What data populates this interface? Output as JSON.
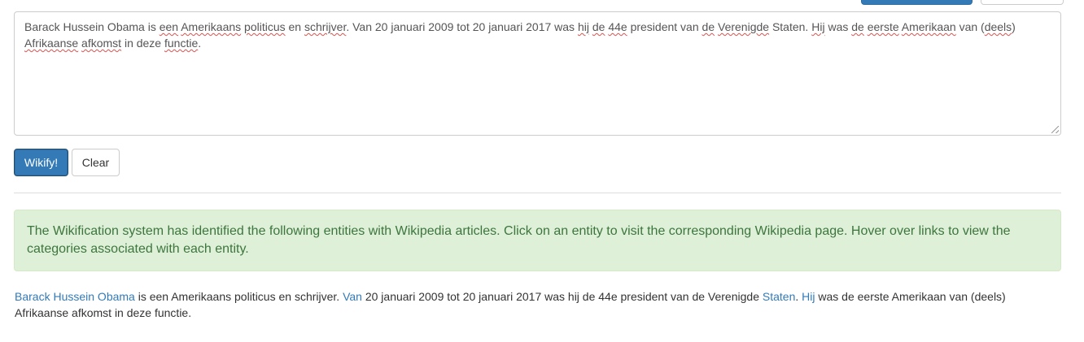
{
  "top_buttons": {
    "primary": "",
    "secondary": ""
  },
  "editor": {
    "segments": [
      {
        "text": "Barack Hussein Obama is ",
        "spell": false
      },
      {
        "text": "een",
        "spell": true
      },
      {
        "text": " ",
        "spell": false
      },
      {
        "text": "Amerikaans",
        "spell": true
      },
      {
        "text": " ",
        "spell": false
      },
      {
        "text": "politicus",
        "spell": true
      },
      {
        "text": " en ",
        "spell": false
      },
      {
        "text": "schrijver",
        "spell": true
      },
      {
        "text": ". Van 20 januari 2009 tot 20 januari 2017 was ",
        "spell": false
      },
      {
        "text": "hij",
        "spell": true
      },
      {
        "text": " ",
        "spell": false
      },
      {
        "text": "de",
        "spell": true
      },
      {
        "text": " ",
        "spell": false
      },
      {
        "text": "44e",
        "spell": true
      },
      {
        "text": " president van ",
        "spell": false
      },
      {
        "text": "de",
        "spell": true
      },
      {
        "text": " ",
        "spell": false
      },
      {
        "text": "Verenigde",
        "spell": true
      },
      {
        "text": " Staten. ",
        "spell": false
      },
      {
        "text": "Hij",
        "spell": true
      },
      {
        "text": " was ",
        "spell": false
      },
      {
        "text": "de",
        "spell": true
      },
      {
        "text": " ",
        "spell": false
      },
      {
        "text": "eerste",
        "spell": true
      },
      {
        "text": " ",
        "spell": false
      },
      {
        "text": "Amerikaan",
        "spell": true
      },
      {
        "text": " van (",
        "spell": false
      },
      {
        "text": "deels",
        "spell": true
      },
      {
        "text": ")",
        "spell": false
      },
      {
        "text": "\n",
        "spell": false
      },
      {
        "text": "Afrikaanse",
        "spell": true
      },
      {
        "text": " ",
        "spell": false
      },
      {
        "text": "afkomst",
        "spell": true
      },
      {
        "text": " in deze ",
        "spell": false
      },
      {
        "text": "functie",
        "spell": true
      },
      {
        "text": ".",
        "spell": false
      }
    ]
  },
  "buttons": {
    "wikify": "Wikify!",
    "clear": "Clear"
  },
  "alert": {
    "message": "The Wikification system has identified the following entities with Wikipedia articles. Click on an entity to visit the corresponding Wikipedia page. Hover over links to view the categories associated with each entity."
  },
  "result": {
    "segments": [
      {
        "text": "Barack Hussein Obama",
        "link": true
      },
      {
        "text": " is een Amerikaans politicus en schrijver. ",
        "link": false
      },
      {
        "text": "Van",
        "link": true
      },
      {
        "text": " 20 januari 2009 tot 20 januari 2017 was hij de 44e president van de Verenigde ",
        "link": false
      },
      {
        "text": "Staten",
        "link": true
      },
      {
        "text": ". ",
        "link": false
      },
      {
        "text": "Hij",
        "link": true
      },
      {
        "text": " was de eerste Amerikaan van (deels)",
        "link": false
      },
      {
        "text": "\n",
        "link": false
      },
      {
        "text": "Afrikaanse afkomst in deze functie.",
        "link": false
      }
    ]
  },
  "colors": {
    "primary": "#337ab7",
    "alert_bg": "#dff0d8",
    "alert_text": "#3c763d",
    "link": "#337ab7"
  }
}
